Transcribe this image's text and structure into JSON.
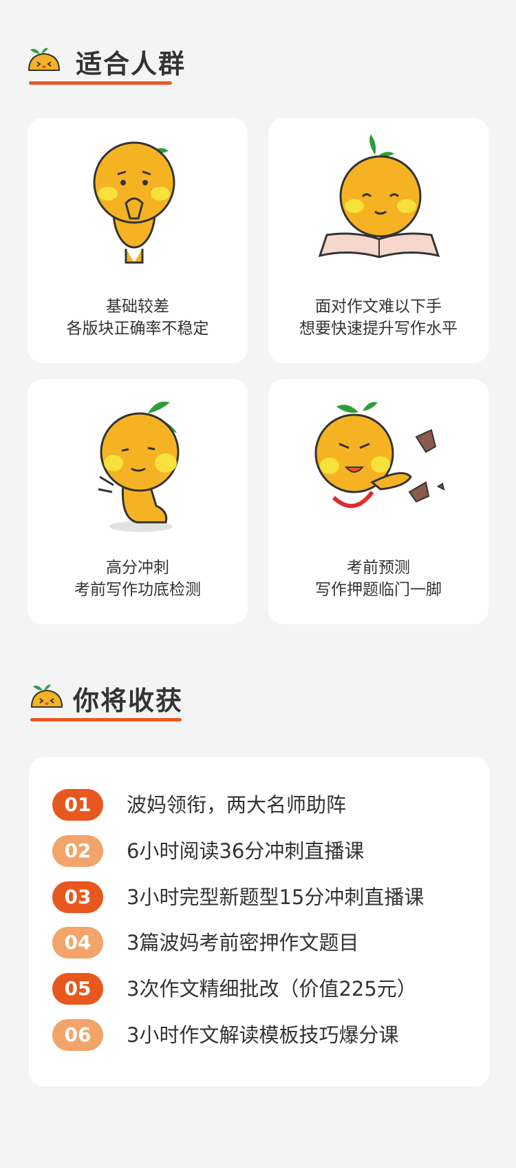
{
  "suitable": {
    "title": "适合人群",
    "cards": [
      {
        "line1": "基础较差",
        "line2": "各版块正确率不稳定",
        "icon": "praying-mascot-icon"
      },
      {
        "line1": "面对作文难以下手",
        "line2": "想要快速提升写作水平",
        "icon": "reading-mascot-icon"
      },
      {
        "line1": "高分冲刺",
        "line2": "考前写作功底检测",
        "icon": "kneeling-mascot-icon"
      },
      {
        "line1": "考前预测",
        "line2": "写作押题临门一脚",
        "icon": "kicking-mascot-icon"
      }
    ]
  },
  "gains": {
    "title": "你将收获",
    "items": [
      {
        "num": "01",
        "text": "波妈领衔，两大名师助阵"
      },
      {
        "num": "02",
        "text": "6小时阅读36分冲刺直播课"
      },
      {
        "num": "03",
        "text": "3小时完型新题型15分冲刺直播课"
      },
      {
        "num": "04",
        "text": "3篇波妈考前密押作文题目"
      },
      {
        "num": "05",
        "text": "3次作文精细批改（价值225元）"
      },
      {
        "num": "06",
        "text": "3小时作文解读模板技巧爆分课"
      }
    ]
  },
  "colors": {
    "accent": "#e8571d",
    "accent_light": "#f2a46a",
    "mascot_orange": "#f5b324",
    "leaf_green": "#2f9e3a",
    "background": "#f4f4f4"
  }
}
